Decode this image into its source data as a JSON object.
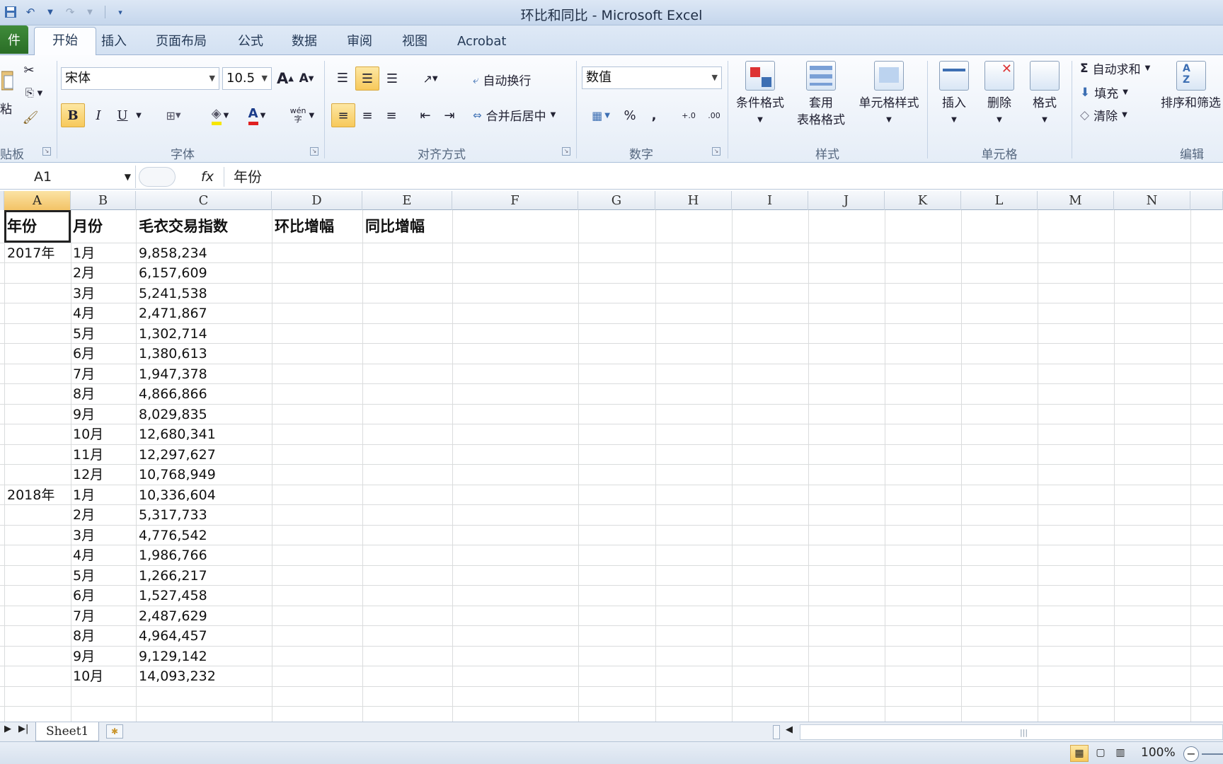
{
  "window": {
    "title": "环比和同比 - Microsoft Excel"
  },
  "qat": {
    "save_icon": "save-icon",
    "undo_icon": "undo-icon",
    "redo_icon": "redo-icon"
  },
  "tabs": {
    "file": "件",
    "home": "开始",
    "insert": "插入",
    "layout": "页面布局",
    "formulas": "公式",
    "data": "数据",
    "review": "审阅",
    "view": "视图",
    "acrobat": "Acrobat"
  },
  "ribbon": {
    "clipboard": {
      "paste_label": "粘",
      "group_label": "贴板"
    },
    "font": {
      "name": "宋体",
      "size": "10.5",
      "bold": "B",
      "italic": "I",
      "underline": "U",
      "font_color_glyph": "A",
      "group_label": "字体",
      "phonetic_glyph": "wén",
      "grow_glyph": "A",
      "shrink_glyph": "A"
    },
    "alignment": {
      "wrap_text": "自动换行",
      "merge_center": "合并后居中",
      "group_label": "对齐方式"
    },
    "number": {
      "format": "数值",
      "percent": "%",
      "comma": ",",
      "group_label": "数字",
      "inc_decimal": "+.0",
      "dec_decimal": ".00"
    },
    "styles": {
      "conditional": "条件格式",
      "table_format_1": "套用",
      "table_format_2": "表格格式",
      "cell_styles": "单元格样式",
      "group_label": "样式"
    },
    "cells": {
      "insert": "插入",
      "delete": "删除",
      "format": "格式",
      "group_label": "单元格"
    },
    "editing": {
      "autosum": "自动求和",
      "fill": "填充",
      "clear": "清除",
      "sort_filter": "排序和筛选",
      "group_label": "编辑",
      "sigma": "Σ"
    }
  },
  "formula_bar": {
    "name_box": "A1",
    "fx": "fx",
    "content": "年份"
  },
  "columns": [
    "A",
    "B",
    "C",
    "D",
    "E",
    "F",
    "G",
    "H",
    "I",
    "J",
    "K",
    "L",
    "M",
    "N"
  ],
  "sheet": {
    "headers": {
      "A": "年份",
      "B": "月份",
      "C": "毛衣交易指数",
      "D": "环比增幅",
      "E": "同比增幅"
    },
    "rows": [
      {
        "year": "2017年",
        "month": "1月",
        "value": "9,858,234"
      },
      {
        "year": "",
        "month": "2月",
        "value": "6,157,609"
      },
      {
        "year": "",
        "month": "3月",
        "value": "5,241,538"
      },
      {
        "year": "",
        "month": "4月",
        "value": "2,471,867"
      },
      {
        "year": "",
        "month": "5月",
        "value": "1,302,714"
      },
      {
        "year": "",
        "month": "6月",
        "value": "1,380,613"
      },
      {
        "year": "",
        "month": "7月",
        "value": "1,947,378"
      },
      {
        "year": "",
        "month": "8月",
        "value": "4,866,866"
      },
      {
        "year": "",
        "month": "9月",
        "value": "8,029,835"
      },
      {
        "year": "",
        "month": "10月",
        "value": "12,680,341"
      },
      {
        "year": "",
        "month": "11月",
        "value": "12,297,627"
      },
      {
        "year": "",
        "month": "12月",
        "value": "10,768,949"
      },
      {
        "year": "2018年",
        "month": "1月",
        "value": "10,336,604"
      },
      {
        "year": "",
        "month": "2月",
        "value": "5,317,733"
      },
      {
        "year": "",
        "month": "3月",
        "value": "4,776,542"
      },
      {
        "year": "",
        "month": "4月",
        "value": "1,986,766"
      },
      {
        "year": "",
        "month": "5月",
        "value": "1,266,217"
      },
      {
        "year": "",
        "month": "6月",
        "value": "1,527,458"
      },
      {
        "year": "",
        "month": "7月",
        "value": "2,487,629"
      },
      {
        "year": "",
        "month": "8月",
        "value": "4,964,457"
      },
      {
        "year": "",
        "month": "9月",
        "value": "9,129,142"
      },
      {
        "year": "",
        "month": "10月",
        "value": "14,093,232"
      }
    ]
  },
  "sheet_tabs": {
    "sheet1": "Sheet1"
  },
  "status": {
    "zoom": "100%",
    "zoom_out": "−"
  },
  "colors": {
    "accent_selected": "#f7c95b",
    "file_tab": "#2a6d26",
    "grid_line": "#dadcdd"
  }
}
